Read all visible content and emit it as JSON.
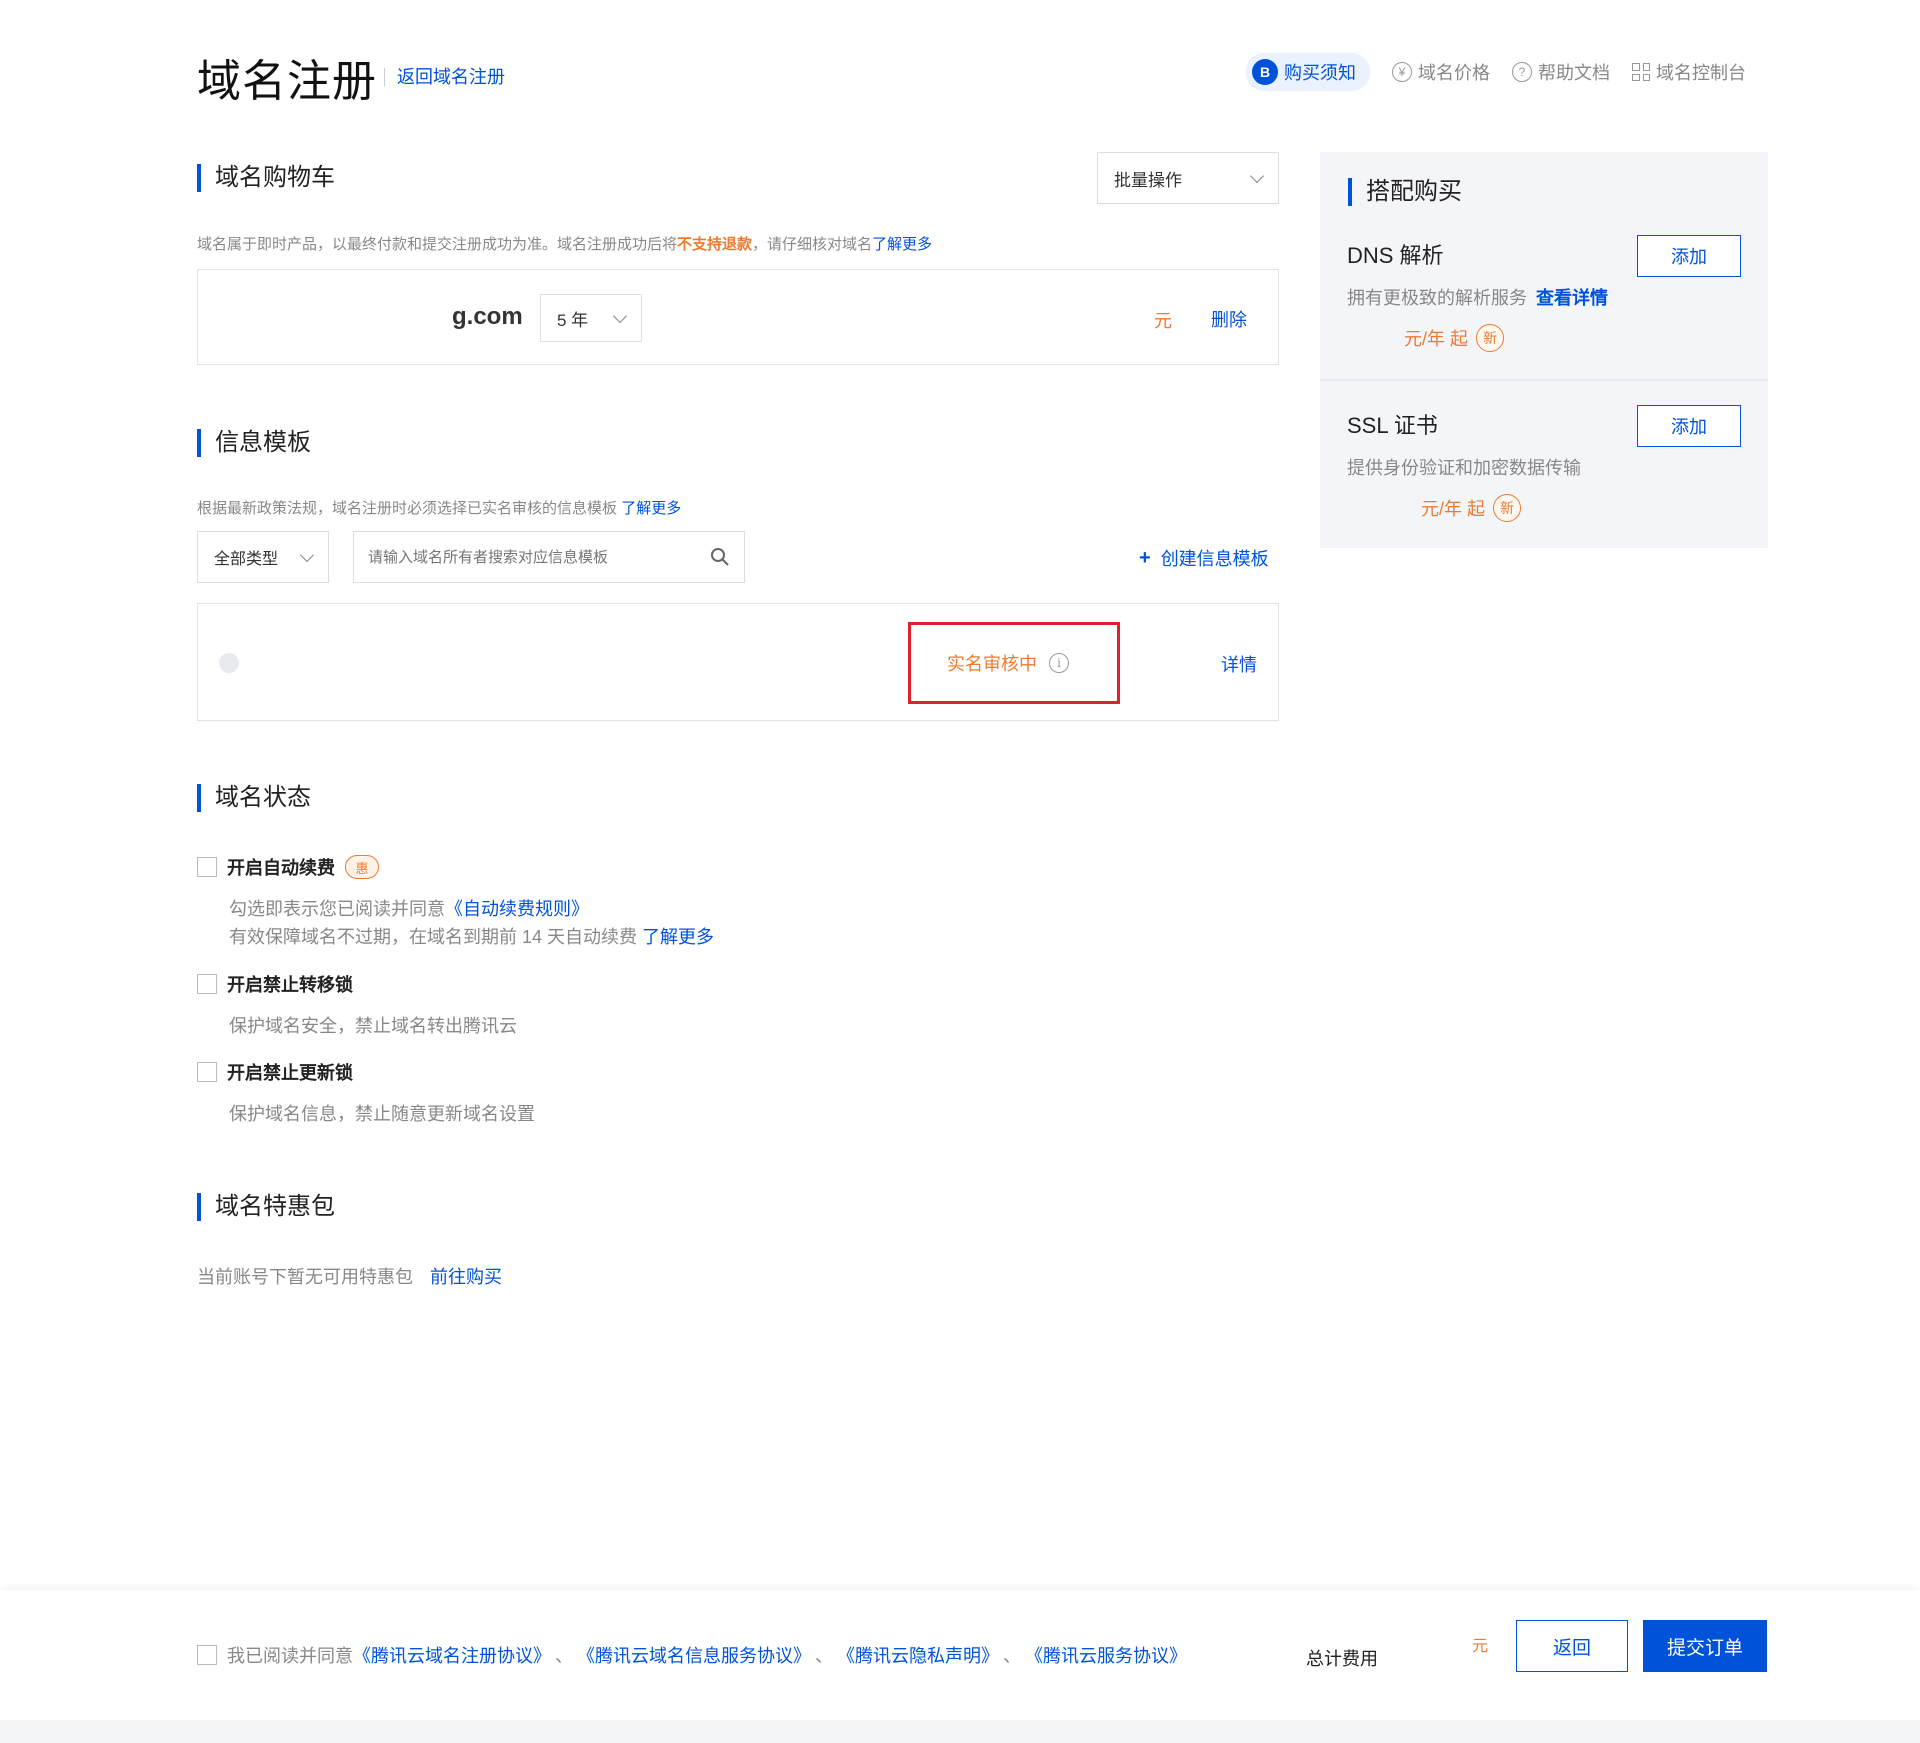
{
  "header": {
    "title": "域名注册",
    "back_link": "返回域名注册",
    "nav": {
      "purchase_notice": "购买须知",
      "purchase_notice_badge": "B",
      "domain_price": "域名价格",
      "domain_price_icon": "¥",
      "help_docs": "帮助文档",
      "help_docs_icon": "?",
      "domain_console": "域名控制台"
    }
  },
  "cart": {
    "title": "域名购物车",
    "batch_ops": "批量操作",
    "desc_prefix": "域名属于即时产品，以最终付款和提交注册成功为准。域名注册成功后将",
    "desc_warn": "不支持退款",
    "desc_suffix": "，请仔细核对域名",
    "desc_link": "了解更多",
    "item": {
      "domain": "g.com",
      "years": "5 年",
      "currency": "元",
      "delete": "删除"
    }
  },
  "template": {
    "title": "信息模板",
    "desc": "根据最新政策法规，域名注册时必须选择已实名审核的信息模板",
    "desc_link": "了解更多",
    "type_select": "全部类型",
    "search_placeholder": "请输入域名所有者搜索对应信息模板",
    "create": "创建信息模板",
    "create_icon": "+",
    "row": {
      "status": "实名审核中",
      "status_icon": "i",
      "detail": "详情"
    }
  },
  "status": {
    "title": "域名状态",
    "options": [
      {
        "label": "开启自动续费",
        "badge": "惠",
        "desc1_prefix": "勾选即表示您已阅读并同意",
        "desc1_link": "《自动续费规则》",
        "desc2_prefix": "有效保障域名不过期，在域名到期前 14 天自动续费",
        "desc2_link": "了解更多"
      },
      {
        "label": "开启禁止转移锁",
        "desc": "保护域名安全，禁止域名转出腾讯云"
      },
      {
        "label": "开启禁止更新锁",
        "desc": "保护域名信息，禁止随意更新域名设置"
      }
    ]
  },
  "package": {
    "title": "域名特惠包",
    "desc": "当前账号下暂无可用特惠包",
    "link": "前往购买"
  },
  "side": {
    "title": "搭配购买",
    "items": [
      {
        "name": "DNS 解析",
        "desc": "拥有更极致的解析服务",
        "link": "查看详情",
        "price": "元/年 起",
        "badge": "新",
        "button": "添加"
      },
      {
        "name": "SSL 证书",
        "desc": "提供身份验证和加密数据传输",
        "price": "元/年 起",
        "badge": "新",
        "button": "添加"
      }
    ]
  },
  "footer": {
    "agree_prefix": "我已阅读并同意",
    "agreements": [
      "《腾讯云域名注册协议》",
      "《腾讯云域名信息服务协议》",
      "《腾讯云隐私声明》",
      "《腾讯云服务协议》"
    ],
    "separator": "、",
    "total_label": "总计费用",
    "currency": "元",
    "back": "返回",
    "submit": "提交订单"
  },
  "colors": {
    "primary": "#0052d9",
    "warning": "#ed7b2f",
    "highlight_border": "#e0202a"
  }
}
